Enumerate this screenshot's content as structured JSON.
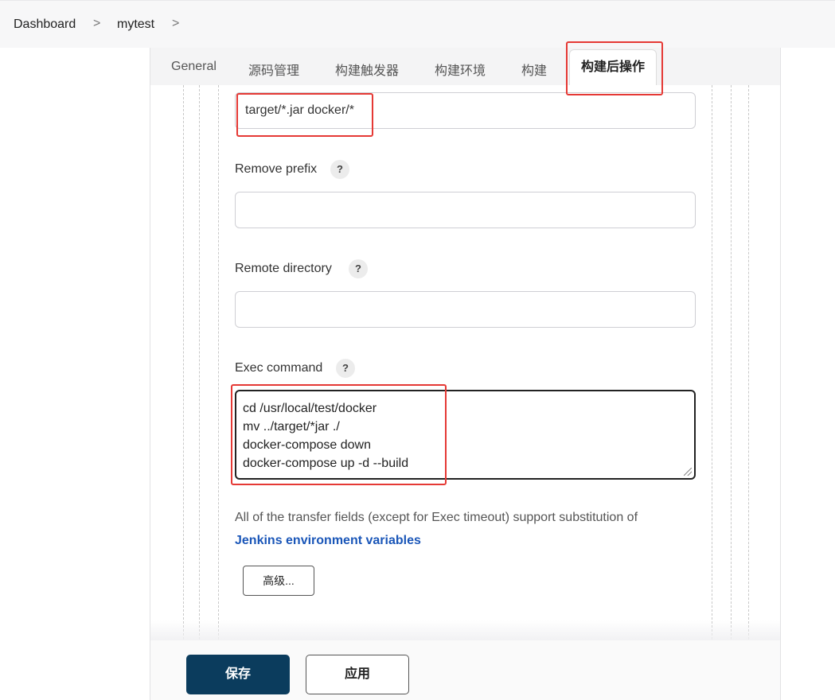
{
  "breadcrumb": {
    "items": [
      "Dashboard",
      "mytest"
    ],
    "separator": ">"
  },
  "tabs": [
    {
      "label": "General"
    },
    {
      "label": "源码管理"
    },
    {
      "label": "构建触发器"
    },
    {
      "label": "构建环境"
    },
    {
      "label": "构建"
    },
    {
      "label": "构建后操作",
      "active": true
    }
  ],
  "form": {
    "source_files": {
      "value": "target/*.jar docker/*"
    },
    "remove_prefix": {
      "label": "Remove prefix",
      "value": ""
    },
    "remote_directory": {
      "label": "Remote directory",
      "value": ""
    },
    "exec_command": {
      "label": "Exec command",
      "lines": [
        "cd /usr/local/test/docker",
        "mv ../target/*jar ./",
        "docker-compose down",
        "docker-compose up -d --build"
      ]
    },
    "help_glyph": "?",
    "note": "All of the transfer fields (except for Exec timeout) support substitution of",
    "link": "Jenkins environment variables",
    "advanced_button": "高级..."
  },
  "footer": {
    "save_label": "保存",
    "apply_label": "应用"
  },
  "colors": {
    "save_bg": "#0b3c5d",
    "highlight": "#e53935",
    "link": "#1a56b8"
  }
}
